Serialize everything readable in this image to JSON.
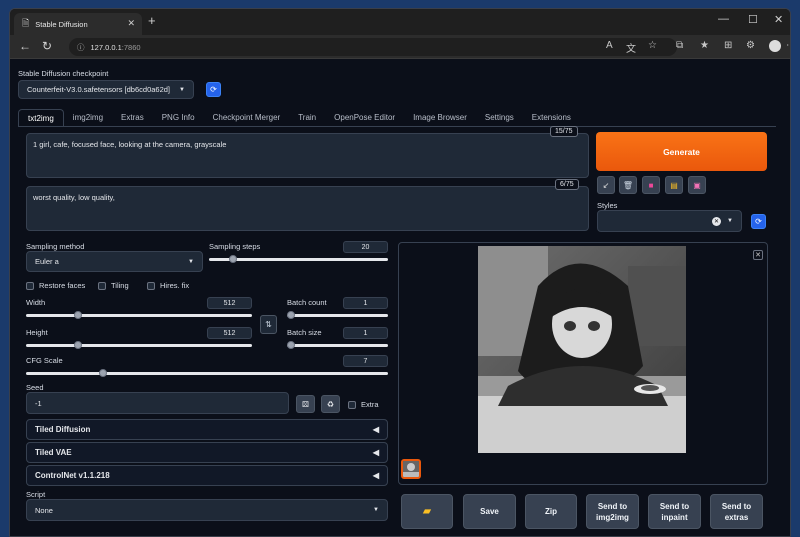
{
  "browser": {
    "tab_title": "Stable Diffusion",
    "url_host": "127.0.0.1",
    "url_port": ":7860"
  },
  "checkpoint": {
    "label": "Stable Diffusion checkpoint",
    "value": "Counterfeit-V3.0.safetensors [db6cd0a62d]"
  },
  "tabs": [
    "txt2img",
    "img2img",
    "Extras",
    "PNG Info",
    "Checkpoint Merger",
    "Train",
    "OpenPose Editor",
    "Image Browser",
    "Settings",
    "Extensions"
  ],
  "prompt": {
    "positive": "1 girl, cafe, focused face, looking at the camera, grayscale",
    "positive_count": "15/75",
    "negative": "worst quality,  low quality,",
    "negative_count": "6/75"
  },
  "generate_label": "Generate",
  "styles_label": "Styles",
  "sampling": {
    "method_label": "Sampling method",
    "method_value": "Euler a",
    "steps_label": "Sampling steps",
    "steps_value": "20",
    "steps_fraction": 0.13
  },
  "options": {
    "restore_faces": "Restore faces",
    "tiling": "Tiling",
    "hires_fix": "Hires. fix"
  },
  "size": {
    "width_label": "Width",
    "width_value": "512",
    "height_label": "Height",
    "height_value": "512",
    "batch_count_label": "Batch count",
    "batch_count_value": "1",
    "batch_size_label": "Batch size",
    "batch_size_value": "1"
  },
  "cfg": {
    "label": "CFG Scale",
    "value": "7",
    "fraction": 0.2
  },
  "seed": {
    "label": "Seed",
    "value": "-1",
    "extra_label": "Extra"
  },
  "accordions": [
    "Tiled Diffusion",
    "Tiled VAE",
    "ControlNet v1.1.218"
  ],
  "script": {
    "label": "Script",
    "value": "None"
  },
  "actions": {
    "save": "Save",
    "zip": "Zip",
    "send_img2img": "Send to img2img",
    "send_inpaint": "Send to inpaint",
    "send_extras": "Send to extras"
  },
  "colors": {
    "accent_orange": "#ea580c",
    "button_blue": "#2563eb",
    "background": "#0b0f19"
  }
}
